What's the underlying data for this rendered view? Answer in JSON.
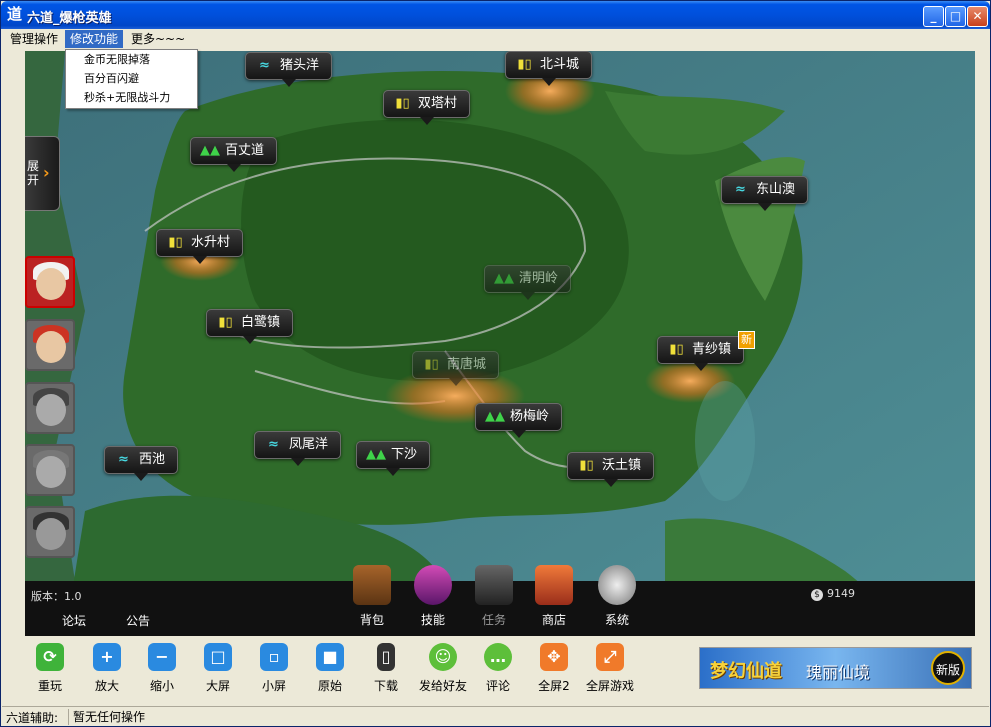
{
  "window": {
    "title": "六道_爆枪英雄",
    "icon": "道",
    "minimize_icon": "minimize-icon",
    "maximize_icon": "maximize-icon",
    "close_icon": "close-icon"
  },
  "menu": {
    "items": [
      "管理操作",
      "修改功能",
      "更多~~~"
    ],
    "dropdown": [
      "金币无限掉落",
      "百分百闪避",
      "秒杀+无限战斗力"
    ]
  },
  "map": {
    "expand_label": "展开",
    "markers": [
      {
        "name": "猪头洋",
        "icon": "wave-icon"
      },
      {
        "name": "北斗城",
        "icon": "house-icon"
      },
      {
        "name": "双塔村",
        "icon": "house-icon"
      },
      {
        "name": "百丈道",
        "icon": "tree-icon"
      },
      {
        "name": "东山澳",
        "icon": "wave-icon"
      },
      {
        "name": "水升村",
        "icon": "house-icon"
      },
      {
        "name": "清明岭",
        "icon": "tree-icon"
      },
      {
        "name": "白鹭镇",
        "icon": "house-icon"
      },
      {
        "name": "青纱镇",
        "icon": "house-icon",
        "badge": "新"
      },
      {
        "name": "南唐城",
        "icon": "house-icon"
      },
      {
        "name": "杨梅岭",
        "icon": "tree-icon"
      },
      {
        "name": "凤尾洋",
        "icon": "wave-icon"
      },
      {
        "name": "下沙",
        "icon": "tree-icon"
      },
      {
        "name": "西池",
        "icon": "wave-icon"
      },
      {
        "name": "沃土镇",
        "icon": "house-icon"
      }
    ]
  },
  "hud": {
    "version": "版本：1.0",
    "coins": "9149",
    "links": [
      "论坛",
      "公告"
    ],
    "buttons": [
      "背包",
      "技能",
      "任务",
      "商店",
      "系统"
    ]
  },
  "toolbar": {
    "items": [
      "重玩",
      "放大",
      "缩小",
      "大屏",
      "小屏",
      "原始",
      "下载",
      "发给好友",
      "评论",
      "全屏2",
      "全屏游戏"
    ],
    "icons": [
      "refresh-icon",
      "zoom-in-icon",
      "zoom-out-icon",
      "big-screen-icon",
      "small-screen-icon",
      "original-icon",
      "phone-icon",
      "share-icon",
      "comment-icon",
      "fullscreen2-icon",
      "fullscreen-icon"
    ]
  },
  "banner": {
    "text1": "梦幻仙道",
    "text2": "瑰丽仙境",
    "badge": "新版"
  },
  "status": {
    "label": "六道辅助:",
    "value": "暂无任何操作"
  }
}
